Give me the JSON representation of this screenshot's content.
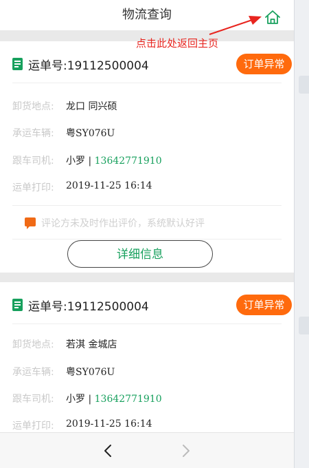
{
  "header": {
    "title": "物流查询",
    "home_icon": "home-icon"
  },
  "annotation": {
    "text": "点击此处返回主页",
    "color": "#e8251f"
  },
  "colors": {
    "accent_green": "#17a05d",
    "badge_orange": "#ff6a0d",
    "muted_label": "#c9c9c9"
  },
  "cards": [
    {
      "waybill": "运单号:19112500004",
      "status_badge": "订单异常",
      "fields": [
        {
          "label": "卸货地点:",
          "value": "龙口 同兴硕"
        },
        {
          "label": "承运车辆:",
          "value": "粤SY076U"
        },
        {
          "label": "跟车司机:",
          "value": "小罗 | ",
          "phone": "13642771910"
        },
        {
          "label": "运单打印:",
          "value": "2019-11-25 16:14"
        }
      ],
      "comment": "评论方未及时作出评价，系统默认好评",
      "detail_button": "详细信息"
    },
    {
      "waybill": "运单号:19112500004",
      "status_badge": "订单异常",
      "fields": [
        {
          "label": "卸货地点:",
          "value": "若淇 金城店"
        },
        {
          "label": "承运车辆:",
          "value": "粤SY076U"
        },
        {
          "label": "跟车司机:",
          "value": "小罗 | ",
          "phone": "13642771910"
        },
        {
          "label": "运单打印:",
          "value": "2019-11-25 16:14"
        }
      ]
    }
  ],
  "bottom_nav": {
    "back_icon": "chevron-left-icon",
    "forward_icon": "chevron-right-icon"
  }
}
